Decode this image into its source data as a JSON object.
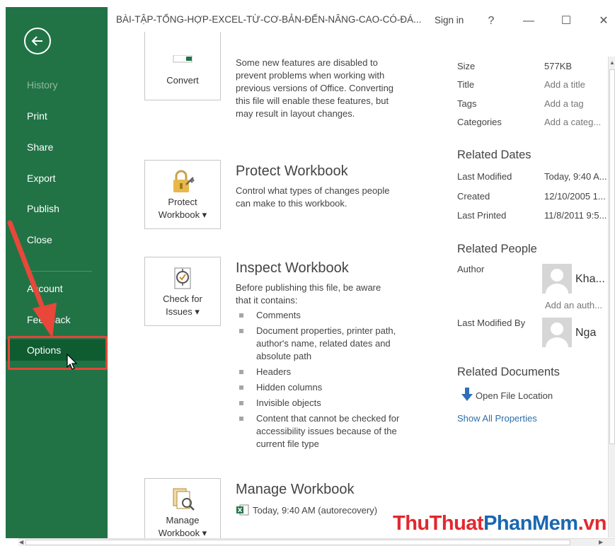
{
  "window": {
    "title": "BÀI-TẬP-TỔNG-HỢP-EXCEL-TỪ-CƠ-BẢN-ĐẾN-NÂNG-CAO-CÓ-ĐÁ...",
    "sign_in": "Sign in",
    "help": "?",
    "minimize": "—",
    "maximize": "☐",
    "close": "✕"
  },
  "sidebar": {
    "accent_color": "#217346",
    "items": [
      {
        "label": "History"
      },
      {
        "label": "Print"
      },
      {
        "label": "Share"
      },
      {
        "label": "Export"
      },
      {
        "label": "Publish"
      },
      {
        "label": "Close"
      },
      {
        "label": "Account"
      },
      {
        "label": "Feedback"
      },
      {
        "label": "Options"
      }
    ]
  },
  "main": {
    "convert": {
      "button_label": "Convert",
      "desc": "Some new features are disabled to prevent problems when working with previous versions of Office. Converting this file will enable these features, but may result in layout changes."
    },
    "protect": {
      "title": "Protect Workbook",
      "button_line1": "Protect",
      "button_line2": "Workbook ▾",
      "desc": "Control what types of changes people can make to this workbook."
    },
    "inspect": {
      "title": "Inspect Workbook",
      "button_line1": "Check for",
      "button_line2": "Issues ▾",
      "desc": "Before publishing this file, be aware that it contains:",
      "bullets": [
        "Comments",
        "Document properties, printer path, author's name, related dates and absolute path",
        "Headers",
        "Hidden columns",
        "Invisible objects",
        "Content that cannot be checked for accessibility issues because of the current file type"
      ]
    },
    "manage": {
      "title": "Manage Workbook",
      "button_line1": "Manage",
      "button_line2": "Workbook ▾",
      "version": "Today, 9:40 AM (autorecovery)"
    }
  },
  "properties": {
    "rows": [
      {
        "label": "Size",
        "value": "577KB"
      },
      {
        "label": "Title",
        "value": "Add a title"
      },
      {
        "label": "Tags",
        "value": "Add a tag"
      },
      {
        "label": "Categories",
        "value": "Add a categ..."
      }
    ],
    "related_dates": {
      "heading": "Related Dates",
      "rows": [
        {
          "label": "Last Modified",
          "value": "Today, 9:40 A..."
        },
        {
          "label": "Created",
          "value": "12/10/2005 1..."
        },
        {
          "label": "Last Printed",
          "value": "11/8/2011 9:5..."
        }
      ]
    },
    "related_people": {
      "heading": "Related People",
      "author_label": "Author",
      "author_name": "Kha...",
      "add_author": "Add an auth...",
      "last_modified_by_label": "Last Modified By",
      "last_modified_by_name": "Nga"
    },
    "related_documents": {
      "heading": "Related Documents",
      "open_location": "Open File Location",
      "show_all": "Show All Properties"
    }
  },
  "watermark": {
    "part1": "ThuThuat",
    "part2": "PhanMem",
    "part3": ".vn"
  }
}
